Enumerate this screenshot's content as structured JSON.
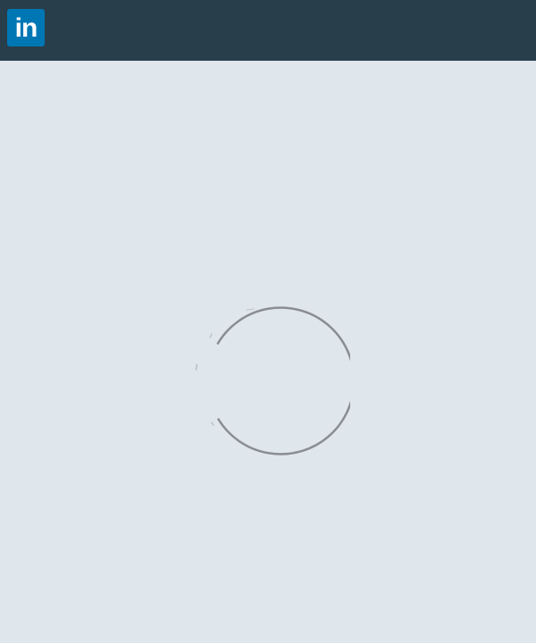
{
  "header": {
    "logo_text": "in",
    "logo_icon": "linkedin-logo-icon",
    "bar_color": "#283e4a",
    "logo_color": "#0077b5"
  },
  "main": {
    "background_color": "#dfe6ec",
    "loading_indicator": {
      "icon": "loading-spinner-icon",
      "color": "#8a8d91"
    }
  }
}
